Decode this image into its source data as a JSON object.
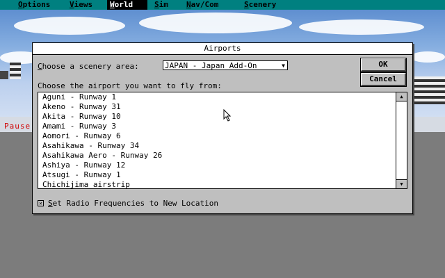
{
  "menubar": {
    "items": [
      {
        "label": "Options",
        "underline": "O",
        "rest": "ptions"
      },
      {
        "label": "Views",
        "underline": "V",
        "rest": "iews"
      },
      {
        "label": "World",
        "underline": "W",
        "rest": "orld"
      },
      {
        "label": "Sim",
        "underline": "S",
        "rest": "im"
      },
      {
        "label": "Nav/Com",
        "underline": "N",
        "rest": "av/Com"
      },
      {
        "label": "Scenery",
        "underline": "S",
        "rest": "cenery"
      }
    ]
  },
  "status": {
    "pause": "Pause"
  },
  "dialog": {
    "title": "Airports",
    "scenery_label_u": "C",
    "scenery_label_rest": "hoose a scenery area:",
    "scenery_value": "JAPAN - Japan Add-On",
    "airport_label": "Choose the airport you want to fly from:",
    "ok_label": "OK",
    "cancel_label": "Cancel",
    "airports": [
      "Aguni - Runway 1",
      "Akeno - Runway 31",
      "Akita - Runway 10",
      "Amami - Runway 3",
      "Aomori - Runway 6",
      "Asahikawa - Runway 34",
      "Asahikawa Aero - Runway 26",
      "Ashiya - Runway 12",
      "Atsugi - Runway 1",
      "Chichijima airstrip"
    ],
    "radio_checked": true,
    "radio_label_u": "S",
    "radio_label_rest": "et Radio Frequencies to New Location"
  }
}
